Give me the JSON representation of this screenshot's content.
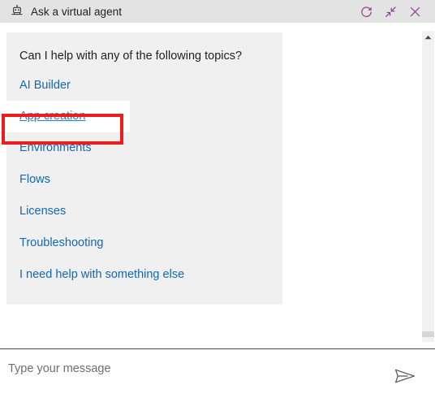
{
  "window": {
    "title": "Ask a virtual agent",
    "agent_icon": "robot-agent-icon",
    "actions": [
      {
        "name": "refresh-button",
        "icon": "refresh-icon",
        "label": "Refresh"
      },
      {
        "name": "minimize-button",
        "icon": "collapse-diagonal-icon",
        "label": "Minimize"
      },
      {
        "name": "close-button",
        "icon": "close-icon",
        "label": "Close"
      }
    ],
    "accent_color": "#8a3d8f",
    "titlebar_bg": "#e3e3e3"
  },
  "conversation": {
    "bot_message": {
      "prompt": "Can I help with any of the following topics?",
      "bubble_bg": "#f0f0f0",
      "link_color": "#1268b3",
      "topics": [
        {
          "label": "AI Builder",
          "hovered": false
        },
        {
          "label": "App creation",
          "hovered": true
        },
        {
          "label": "Environments",
          "hovered": false
        },
        {
          "label": "Flows",
          "hovered": false
        },
        {
          "label": "Licenses",
          "hovered": false
        },
        {
          "label": "Troubleshooting",
          "hovered": false
        },
        {
          "label": "I need help with something else",
          "hovered": false
        }
      ]
    }
  },
  "annotation": {
    "name": "red-highlight-box",
    "target": "App creation",
    "color": "#ee1d1d"
  },
  "scrollbar": {
    "up_arrow_icon": "caret-up-icon",
    "thumb_position": "bottom"
  },
  "composer": {
    "placeholder": "Type your message",
    "value": "",
    "send_icon": "send-paper-plane-icon"
  }
}
